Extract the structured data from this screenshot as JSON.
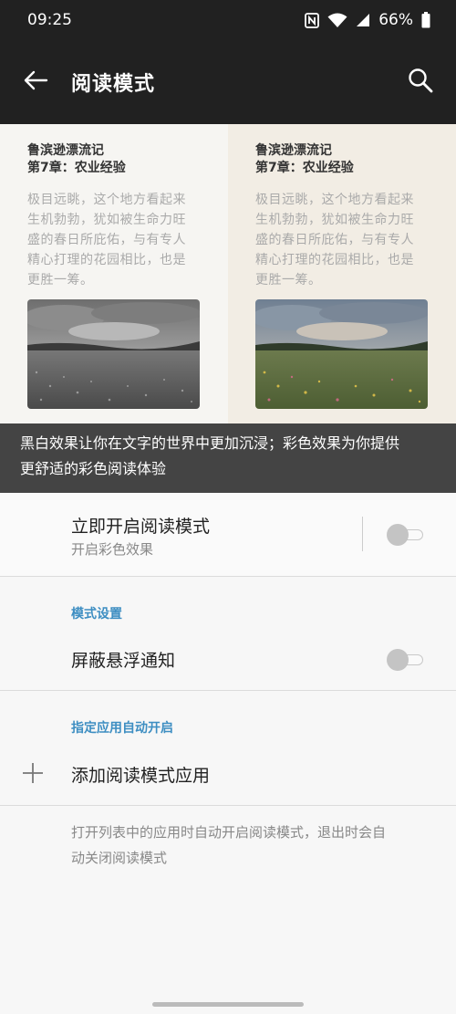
{
  "status_bar": {
    "time": "09:25",
    "battery": "66%"
  },
  "app_bar": {
    "title": "阅读模式"
  },
  "preview": {
    "book_title": "鲁滨逊漂流记",
    "chapter": "第7章：农业经验",
    "text_lines": [
      "极目远眺，这个地方看起来",
      "生机勃勃，犹如被生命力旺",
      "盛的春日所庇佑，与有专人",
      "精心打理的花园相比，也是",
      "更胜一筹。"
    ],
    "caption_lines": [
      "黑白效果让你在文字的世界中更加沉浸；彩色效果为你提供",
      "更舒适的彩色阅读体验"
    ]
  },
  "reading_mode": {
    "title": "立即开启阅读模式",
    "subtitle": "开启彩色效果",
    "enabled": false
  },
  "mode_settings": {
    "section_label": "模式设置",
    "block_floating": {
      "label": "屏蔽悬浮通知",
      "enabled": false
    }
  },
  "auto_apps": {
    "section_label": "指定应用自动开启",
    "add_label": "添加阅读模式应用",
    "footnote_lines": [
      "打开列表中的应用时自动开启阅读模式，退出时会自",
      "动关闭阅读模式"
    ]
  },
  "icons": {
    "back": "arrow-left-icon",
    "search": "search-icon",
    "nfc": "nfc-icon",
    "wifi": "wifi-icon",
    "signal": "signal-icon",
    "battery": "battery-icon",
    "plus": "plus-icon"
  },
  "colors": {
    "accent": "#3d8ec2",
    "bar": "#212121",
    "caption_bg": "#444444"
  }
}
